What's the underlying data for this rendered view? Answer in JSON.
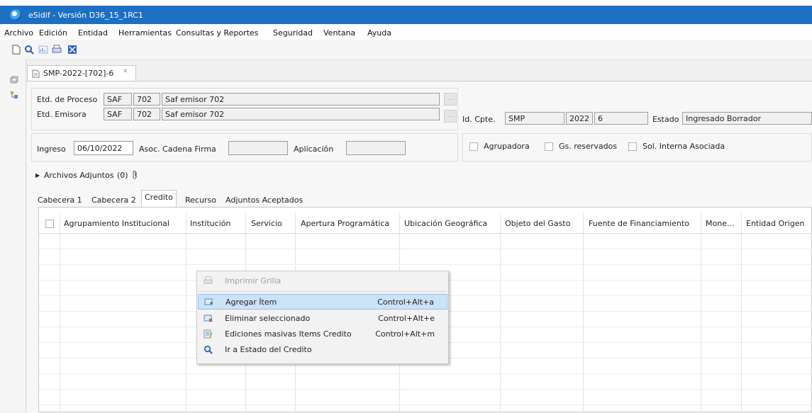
{
  "window": {
    "title": "eSidif - Versión D36_15_1RC1"
  },
  "menubar": [
    "Archivo",
    "Edición",
    "Entidad",
    "Herramientas",
    "Consultas y Reportes",
    "Seguridad",
    "Ventana",
    "Ayuda"
  ],
  "editor_tab": {
    "label": "SMP-2022-[702]-6",
    "close": "✕"
  },
  "header": {
    "etd_proceso_label": "Etd. de Proceso",
    "etd_proceso_tipo": "SAF",
    "etd_proceso_codigo": "702",
    "etd_proceso_nombre": "Saf emisor 702",
    "etd_emisora_label": "Etd. Emisora",
    "etd_emisora_tipo": "SAF",
    "etd_emisora_codigo": "702",
    "etd_emisora_nombre": "Saf emisor 702",
    "lookup_btn": "...",
    "id_cpte_label": "Id. Cpte.",
    "id_cpte_tipo": "SMP",
    "id_cpte_anio": "2022",
    "id_cpte_nro": "6",
    "estado_label": "Estado",
    "estado_value": "Ingresado Borrador",
    "ingreso_label": "Ingreso",
    "ingreso_value": "06/10/2022",
    "asoc_label": "Asoc. Cadena Firma",
    "asoc_value": "",
    "aplicacion_label": "Aplicación",
    "aplicacion_value": "",
    "agrupadora_label": "Agrupadora",
    "gs_reservados_label": "Gs. reservados",
    "sol_interna_label": "Sol. Interna Asociada"
  },
  "adjuntos": {
    "label": "Archivos Adjuntos",
    "count": "(0)"
  },
  "tabs": [
    "Cabecera 1",
    "Cabecera 2",
    "Credito",
    "Recurso",
    "Adjuntos Aceptados"
  ],
  "active_tab": "Credito",
  "grid": {
    "columns": [
      "Agrupamiento Institucional",
      "Institución",
      "Servicio",
      "Apertura Programática",
      "Ubicación Geográfica",
      "Objeto del Gasto",
      "Fuente de Financiamiento",
      "Mone...",
      "Entidad Origen"
    ]
  },
  "context_menu": {
    "items": [
      {
        "label": "Imprimir Grilla",
        "shortcut": "",
        "icon": "printer-icon"
      },
      {
        "label": "Agregar Ítem",
        "shortcut": "Control+Alt+a",
        "icon": "add-row-icon"
      },
      {
        "label": "Eliminar seleccionado",
        "shortcut": "Control+Alt+e",
        "icon": "delete-row-icon"
      },
      {
        "label": "Ediciones masivas Items Credito",
        "shortcut": "Control+Alt+m",
        "icon": "bulk-edit-icon"
      },
      {
        "label": "Ir a Estado del Credito",
        "shortcut": "",
        "icon": "magnifier-icon"
      }
    ]
  },
  "colors": {
    "titlebar": "#1d6fc3",
    "menu_highlight": "#cce2f6"
  }
}
